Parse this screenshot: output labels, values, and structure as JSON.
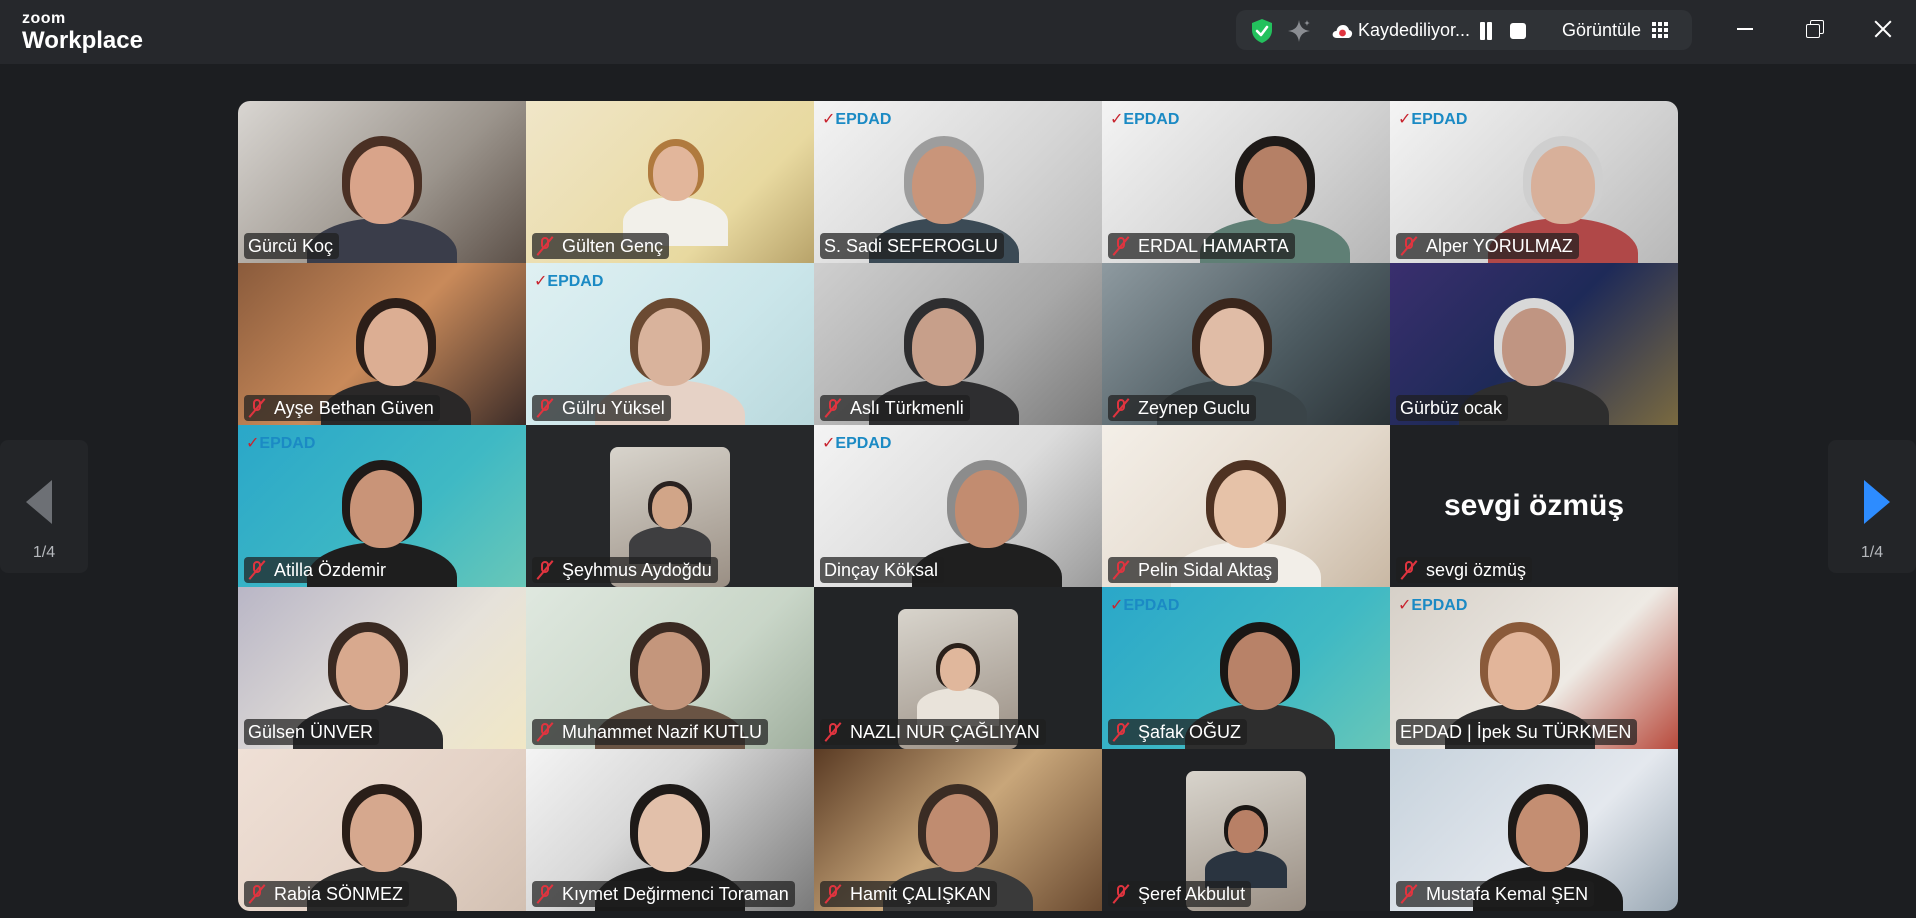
{
  "titlebar": {
    "brand": "zoom",
    "product": "Workplace",
    "recording_label": "Kaydediliyor...",
    "view_label": "Görüntüle",
    "icons": [
      "shield-check-icon",
      "ai-sparkle-icon",
      "cloud-recording-icon",
      "pause-icon",
      "stop-icon",
      "grid-view-icon",
      "minimize-icon",
      "maximize-icon",
      "close-icon"
    ],
    "colors": {
      "shield": "#23c15d",
      "cloud": "#e0343f"
    }
  },
  "pager": {
    "left_label": "1/4",
    "right_label": "1/4",
    "accent": "#2d8cff"
  },
  "gallery": {
    "participants": [
      {
        "name": "Gürcü Koç",
        "muted": false
      },
      {
        "name": "Gülten Genç",
        "muted": true
      },
      {
        "name": "S. Sadi SEFEROGLU",
        "muted": false
      },
      {
        "name": "ERDAL HAMARTA",
        "muted": true
      },
      {
        "name": "Alper YORULMAZ",
        "muted": true
      },
      {
        "name": "Ayşe Bethan Güven",
        "muted": true
      },
      {
        "name": "Gülru Yüksel",
        "muted": true
      },
      {
        "name": "Aslı Türkmenli",
        "muted": true
      },
      {
        "name": "Zeynep Guclu",
        "muted": true
      },
      {
        "name": "Gürbüz ocak",
        "muted": false
      },
      {
        "name": "Atilla Özdemir",
        "muted": true
      },
      {
        "name": "Şeyhmus Aydoğdu",
        "muted": true
      },
      {
        "name": "Dinçay Köksal",
        "muted": false,
        "speaking": true
      },
      {
        "name": "Pelin Sidal Aktaş",
        "muted": true
      },
      {
        "name": "sevgi özmüş",
        "muted": true,
        "video_off": true
      },
      {
        "name": "Gülsen ÜNVER",
        "muted": false
      },
      {
        "name": "Muhammet Nazif KUTLU",
        "muted": true
      },
      {
        "name": "NAZLI NUR ÇAĞLIYAN",
        "muted": true
      },
      {
        "name": "Şafak OĞUZ",
        "muted": true
      },
      {
        "name": "EPDAD | İpek Su TÜRKMEN",
        "muted": false
      },
      {
        "name": "Rabia SÖNMEZ",
        "muted": true
      },
      {
        "name": "Kıymet Değirmenci Toraman",
        "muted": true
      },
      {
        "name": "Hamit ÇALIŞKAN",
        "muted": true
      },
      {
        "name": "Şeref Akbulut",
        "muted": true
      },
      {
        "name": "Mustafa Kemal ŞEN",
        "muted": true
      }
    ],
    "video_off_display_name": "sevgi özmüş",
    "background_logo_text": "EPDAD",
    "speaking_border_color": "#23d18b"
  }
}
